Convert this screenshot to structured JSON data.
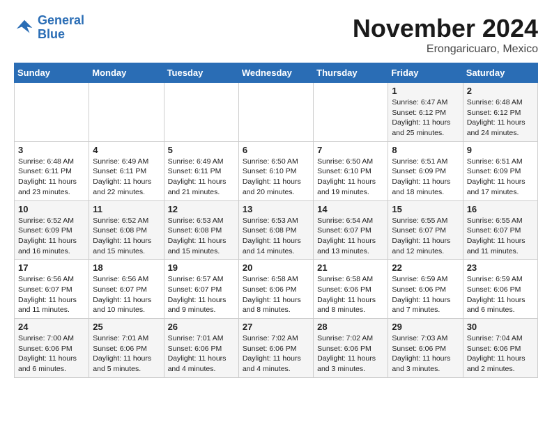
{
  "logo": {
    "line1": "General",
    "line2": "Blue"
  },
  "title": "November 2024",
  "subtitle": "Erongaricuaro, Mexico",
  "days_of_week": [
    "Sunday",
    "Monday",
    "Tuesday",
    "Wednesday",
    "Thursday",
    "Friday",
    "Saturday"
  ],
  "weeks": [
    [
      {
        "day": "",
        "info": ""
      },
      {
        "day": "",
        "info": ""
      },
      {
        "day": "",
        "info": ""
      },
      {
        "day": "",
        "info": ""
      },
      {
        "day": "",
        "info": ""
      },
      {
        "day": "1",
        "info": "Sunrise: 6:47 AM\nSunset: 6:12 PM\nDaylight: 11 hours and 25 minutes."
      },
      {
        "day": "2",
        "info": "Sunrise: 6:48 AM\nSunset: 6:12 PM\nDaylight: 11 hours and 24 minutes."
      }
    ],
    [
      {
        "day": "3",
        "info": "Sunrise: 6:48 AM\nSunset: 6:11 PM\nDaylight: 11 hours and 23 minutes."
      },
      {
        "day": "4",
        "info": "Sunrise: 6:49 AM\nSunset: 6:11 PM\nDaylight: 11 hours and 22 minutes."
      },
      {
        "day": "5",
        "info": "Sunrise: 6:49 AM\nSunset: 6:11 PM\nDaylight: 11 hours and 21 minutes."
      },
      {
        "day": "6",
        "info": "Sunrise: 6:50 AM\nSunset: 6:10 PM\nDaylight: 11 hours and 20 minutes."
      },
      {
        "day": "7",
        "info": "Sunrise: 6:50 AM\nSunset: 6:10 PM\nDaylight: 11 hours and 19 minutes."
      },
      {
        "day": "8",
        "info": "Sunrise: 6:51 AM\nSunset: 6:09 PM\nDaylight: 11 hours and 18 minutes."
      },
      {
        "day": "9",
        "info": "Sunrise: 6:51 AM\nSunset: 6:09 PM\nDaylight: 11 hours and 17 minutes."
      }
    ],
    [
      {
        "day": "10",
        "info": "Sunrise: 6:52 AM\nSunset: 6:09 PM\nDaylight: 11 hours and 16 minutes."
      },
      {
        "day": "11",
        "info": "Sunrise: 6:52 AM\nSunset: 6:08 PM\nDaylight: 11 hours and 15 minutes."
      },
      {
        "day": "12",
        "info": "Sunrise: 6:53 AM\nSunset: 6:08 PM\nDaylight: 11 hours and 15 minutes."
      },
      {
        "day": "13",
        "info": "Sunrise: 6:53 AM\nSunset: 6:08 PM\nDaylight: 11 hours and 14 minutes."
      },
      {
        "day": "14",
        "info": "Sunrise: 6:54 AM\nSunset: 6:07 PM\nDaylight: 11 hours and 13 minutes."
      },
      {
        "day": "15",
        "info": "Sunrise: 6:55 AM\nSunset: 6:07 PM\nDaylight: 11 hours and 12 minutes."
      },
      {
        "day": "16",
        "info": "Sunrise: 6:55 AM\nSunset: 6:07 PM\nDaylight: 11 hours and 11 minutes."
      }
    ],
    [
      {
        "day": "17",
        "info": "Sunrise: 6:56 AM\nSunset: 6:07 PM\nDaylight: 11 hours and 11 minutes."
      },
      {
        "day": "18",
        "info": "Sunrise: 6:56 AM\nSunset: 6:07 PM\nDaylight: 11 hours and 10 minutes."
      },
      {
        "day": "19",
        "info": "Sunrise: 6:57 AM\nSunset: 6:07 PM\nDaylight: 11 hours and 9 minutes."
      },
      {
        "day": "20",
        "info": "Sunrise: 6:58 AM\nSunset: 6:06 PM\nDaylight: 11 hours and 8 minutes."
      },
      {
        "day": "21",
        "info": "Sunrise: 6:58 AM\nSunset: 6:06 PM\nDaylight: 11 hours and 8 minutes."
      },
      {
        "day": "22",
        "info": "Sunrise: 6:59 AM\nSunset: 6:06 PM\nDaylight: 11 hours and 7 minutes."
      },
      {
        "day": "23",
        "info": "Sunrise: 6:59 AM\nSunset: 6:06 PM\nDaylight: 11 hours and 6 minutes."
      }
    ],
    [
      {
        "day": "24",
        "info": "Sunrise: 7:00 AM\nSunset: 6:06 PM\nDaylight: 11 hours and 6 minutes."
      },
      {
        "day": "25",
        "info": "Sunrise: 7:01 AM\nSunset: 6:06 PM\nDaylight: 11 hours and 5 minutes."
      },
      {
        "day": "26",
        "info": "Sunrise: 7:01 AM\nSunset: 6:06 PM\nDaylight: 11 hours and 4 minutes."
      },
      {
        "day": "27",
        "info": "Sunrise: 7:02 AM\nSunset: 6:06 PM\nDaylight: 11 hours and 4 minutes."
      },
      {
        "day": "28",
        "info": "Sunrise: 7:02 AM\nSunset: 6:06 PM\nDaylight: 11 hours and 3 minutes."
      },
      {
        "day": "29",
        "info": "Sunrise: 7:03 AM\nSunset: 6:06 PM\nDaylight: 11 hours and 3 minutes."
      },
      {
        "day": "30",
        "info": "Sunrise: 7:04 AM\nSunset: 6:06 PM\nDaylight: 11 hours and 2 minutes."
      }
    ]
  ]
}
